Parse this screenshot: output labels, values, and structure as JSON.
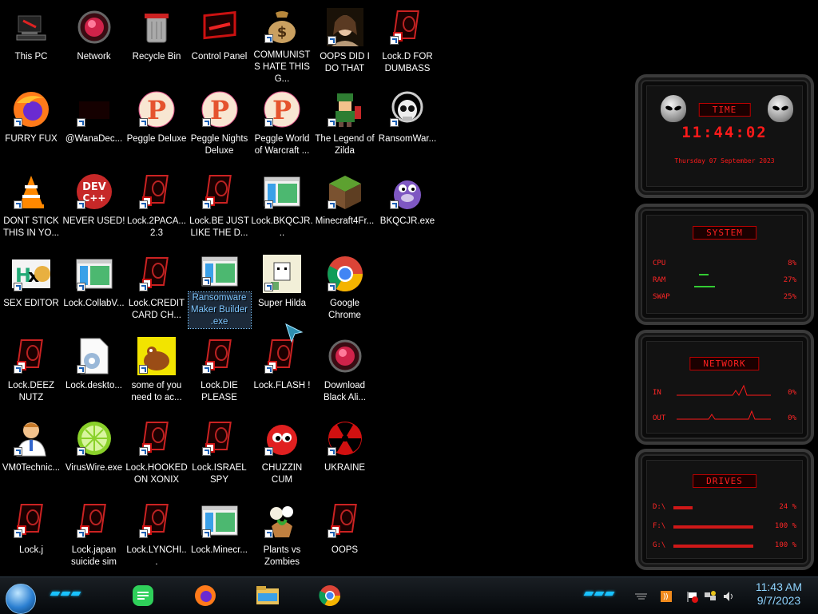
{
  "desktop": {
    "icons": [
      {
        "label": "This PC",
        "type": "pc"
      },
      {
        "label": "FURRY FUX",
        "type": "firefox"
      },
      {
        "label": "DONT STICK THIS IN YO...",
        "type": "vlc"
      },
      {
        "label": "SEX EDITOR",
        "type": "hxd"
      },
      {
        "label": "Lock.DEEZ NUTZ",
        "type": "lock"
      },
      {
        "label": "VM0Technic...",
        "type": "person"
      },
      {
        "label": "Lock.j",
        "type": "lock"
      },
      {
        "label": "Network",
        "type": "red-orb"
      },
      {
        "label": "@WanaDec...",
        "type": "dark"
      },
      {
        "label": "NEVER USED!",
        "type": "devcpp"
      },
      {
        "label": "Lock.CollabV...",
        "type": "window"
      },
      {
        "label": "Lock.deskto...",
        "type": "settings-file"
      },
      {
        "label": "VirusWire.exe",
        "type": "lime"
      },
      {
        "label": "Lock.japan suicide sim",
        "type": "lock"
      },
      {
        "label": "Recycle Bin",
        "type": "bin"
      },
      {
        "label": "Peggle Deluxe",
        "type": "peggle"
      },
      {
        "label": "Lock.2PACA... 2.3",
        "type": "lock"
      },
      {
        "label": "Lock.CREDIT CARD CH...",
        "type": "lock"
      },
      {
        "label": "some of you need to ac...",
        "type": "dog"
      },
      {
        "label": "Lock.HOOKED ON XONIX",
        "type": "lock"
      },
      {
        "label": "Lock.LYNCHI...",
        "type": "lock"
      },
      {
        "label": "Control Panel",
        "type": "control"
      },
      {
        "label": "Peggle Nights Deluxe",
        "type": "peggle"
      },
      {
        "label": "Lock.BE JUST LIKE THE D...",
        "type": "lock"
      },
      {
        "label": "Ransomware Maker Builder .exe",
        "type": "window",
        "selected": true
      },
      {
        "label": "Lock.DIE PLEASE",
        "type": "lock"
      },
      {
        "label": "Lock.ISRAEL SPY",
        "type": "lock"
      },
      {
        "label": "Lock.Minecr...",
        "type": "window"
      },
      {
        "label": "COMMUNISTS HATE THIS G...",
        "type": "money"
      },
      {
        "label": "Peggle World of Warcraft ...",
        "type": "peggle"
      },
      {
        "label": "Lock.BKQCJR...",
        "type": "window"
      },
      {
        "label": "Super Hilda",
        "type": "hilda"
      },
      {
        "label": "Lock.FLASH !",
        "type": "lock"
      },
      {
        "label": "CHUZZIN CUM",
        "type": "chuzzle"
      },
      {
        "label": "Plants vs Zombies",
        "type": "pvz"
      },
      {
        "label": "OOPS DID I DO THAT",
        "type": "portrait"
      },
      {
        "label": "The Legend of Zilda",
        "type": "link"
      },
      {
        "label": "Minecraft4Fr...",
        "type": "grass"
      },
      {
        "label": "Google Chrome",
        "type": "chrome"
      },
      {
        "label": "Download Black Ali...",
        "type": "red-orb"
      },
      {
        "label": "UKRAINE",
        "type": "radiation"
      },
      {
        "label": "OOPS",
        "type": "lock"
      },
      {
        "label": "Lock.D FOR DUMBASS",
        "type": "lock"
      },
      {
        "label": "RansomWar...",
        "type": "skull"
      },
      {
        "label": "BKQCJR.exe",
        "type": "bonzi"
      }
    ]
  },
  "widgets": {
    "time": {
      "title": "TIME",
      "clock": "11:44:02",
      "date": "Thursday 07 September 2023"
    },
    "system": {
      "title": "SYSTEM",
      "rows": [
        {
          "label": "CPU",
          "value": "8%"
        },
        {
          "label": "RAM",
          "value": "27%"
        },
        {
          "label": "SWAP",
          "value": "25%"
        }
      ]
    },
    "network": {
      "title": "NETWORK",
      "rows": [
        {
          "label": "IN",
          "value": "0%"
        },
        {
          "label": "OUT",
          "value": "0%"
        }
      ]
    },
    "drives": {
      "title": "DRIVES",
      "rows": [
        {
          "label": "D:\\",
          "value": "24 %",
          "fill": 0.24
        },
        {
          "label": "F:\\",
          "value": "100 %",
          "fill": 1.0
        },
        {
          "label": "G:\\",
          "value": "100 %",
          "fill": 1.0
        }
      ]
    }
  },
  "taskbar": {
    "pinned": [
      "messages-icon",
      "firefox-icon",
      "file-explorer-icon",
      "chrome-icon"
    ],
    "clock": {
      "time": "11:43 AM",
      "date": "9/7/2023"
    }
  },
  "colors": {
    "accent": "#ff1a1a",
    "tray_text": "#8fd4ff",
    "glow": "#19c2ff"
  }
}
